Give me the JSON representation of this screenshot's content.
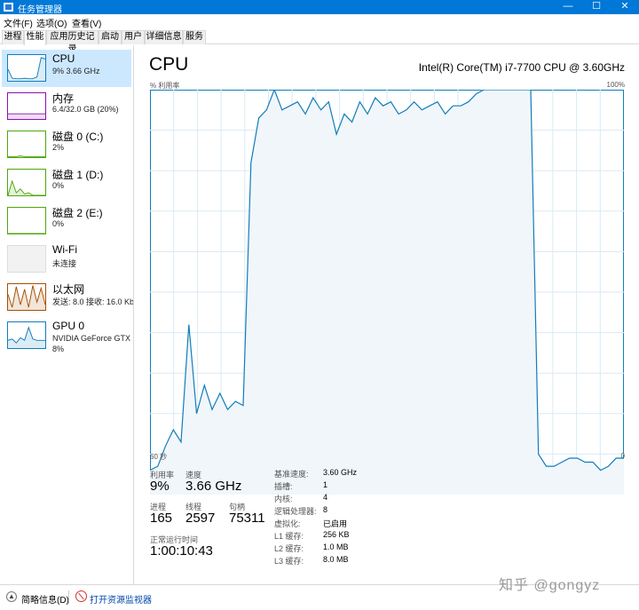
{
  "window": {
    "title": "任务管理器",
    "controls": [
      "—",
      "☐",
      "✕"
    ]
  },
  "menu": [
    "文件(F)",
    "选项(O)",
    "查看(V)"
  ],
  "tabs": [
    "进程",
    "性能",
    "应用历史记录",
    "启动",
    "用户",
    "详细信息",
    "服务"
  ],
  "active_tab": "性能",
  "sidebar": [
    {
      "name": "CPU",
      "sub": "9% 3.66 GHz",
      "color": "#117dbb",
      "spark": [
        0.45,
        0.1,
        0.08,
        0.08,
        0.1,
        0.08,
        0.08,
        0.15,
        0.9,
        0.85
      ]
    },
    {
      "name": "内存",
      "sub": "6.4/32.0 GB (20%)",
      "color": "#8b12ae",
      "spark": [
        0.2,
        0.2,
        0.2,
        0.2,
        0.2,
        0.2,
        0.2,
        0.2,
        0.2,
        0.2
      ]
    },
    {
      "name": "磁盘 0 (C:)",
      "sub": "2%",
      "color": "#4da60c",
      "spark": [
        0.02,
        0.02,
        0.02,
        0.05,
        0.02,
        0.02,
        0.02,
        0.02,
        0.02,
        0.02
      ]
    },
    {
      "name": "磁盘 1 (D:)",
      "sub": "0%",
      "color": "#4da60c",
      "spark": [
        0.0,
        0.55,
        0.1,
        0.25,
        0.05,
        0.1,
        0.0,
        0.0,
        0.0,
        0.0
      ]
    },
    {
      "name": "磁盘 2 (E:)",
      "sub": "0%",
      "color": "#4da60c",
      "spark": [
        0,
        0,
        0,
        0,
        0,
        0,
        0,
        0,
        0,
        0
      ]
    },
    {
      "name": "Wi-Fi",
      "sub": "未连接",
      "color": "#bbbbbb",
      "spark": []
    },
    {
      "name": "以太网",
      "sub": "发送: 8.0  接收: 16.0 Kb",
      "color": "#a74f01",
      "spark": [
        0.6,
        0.1,
        0.9,
        0.2,
        0.8,
        0.1,
        0.95,
        0.3,
        0.85,
        0.2
      ]
    },
    {
      "name": "GPU 0",
      "sub": "NVIDIA GeForce GTX",
      "sub2": "8%",
      "color": "#117dbb",
      "spark": [
        0.3,
        0.35,
        0.2,
        0.4,
        0.3,
        0.8,
        0.35,
        0.3,
        0.3,
        0.3
      ]
    }
  ],
  "main": {
    "title": "CPU",
    "model": "Intel(R) Core(TM) i7-7700 CPU @ 3.60GHz",
    "util_label": "% 利用率",
    "util_max": "100%",
    "time_left": "60 秒",
    "time_right": "0"
  },
  "chart_data": {
    "type": "area",
    "ylim": [
      0,
      100
    ],
    "grid": true,
    "line_color": "#117dbb",
    "fill_color": "#f1f6fa",
    "values": [
      6,
      7,
      12,
      16,
      13,
      42,
      20,
      27,
      21,
      25,
      21,
      23,
      22,
      82,
      93,
      95,
      100,
      95,
      96,
      97,
      94,
      98,
      95,
      97,
      89,
      94,
      92,
      97,
      94,
      98,
      96,
      97,
      94,
      95,
      97,
      95,
      96,
      97,
      94,
      96,
      96,
      97,
      99,
      100,
      100,
      100,
      100,
      100,
      100,
      100,
      10,
      7,
      7,
      8,
      9,
      9,
      8,
      8,
      6,
      7,
      9,
      9
    ]
  },
  "stats": {
    "util_label": "利用率",
    "util_value": "9%",
    "speed_label": "速度",
    "speed_value": "3.66 GHz",
    "proc_label": "进程",
    "proc_value": "165",
    "thread_label": "线程",
    "thread_value": "2597",
    "handle_label": "句柄",
    "handle_value": "75311",
    "uptime_label": "正常运行时间",
    "uptime_value": "1:00:10:43"
  },
  "specs": [
    {
      "label": "基准速度:",
      "value": "3.60 GHz"
    },
    {
      "label": "插槽:",
      "value": "1"
    },
    {
      "label": "内核:",
      "value": "4"
    },
    {
      "label": "逻辑处理器:",
      "value": "8"
    },
    {
      "label": "虚拟化:",
      "value": "已启用"
    },
    {
      "label": "L1 缓存:",
      "value": "256 KB"
    },
    {
      "label": "L2 缓存:",
      "value": "1.0 MB"
    },
    {
      "label": "L3 缓存:",
      "value": "8.0 MB"
    }
  ],
  "footer": {
    "less": "简略信息(D)",
    "open_rm": "打开资源监视器",
    "watermark": "知乎 @gongyz"
  }
}
